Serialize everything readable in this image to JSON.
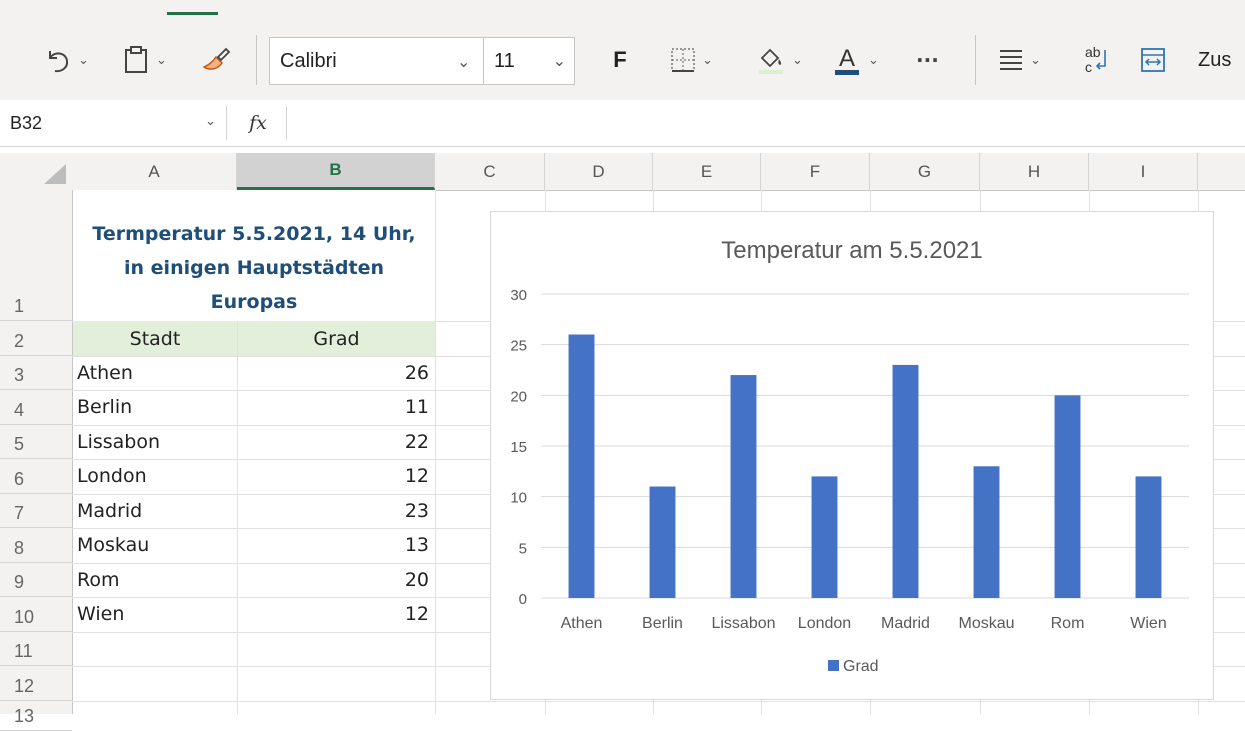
{
  "toolbar": {
    "font_name": "Calibri",
    "font_size": "11",
    "bold_label": "F",
    "more_label": "···",
    "truncated_label": "Zus",
    "icons": [
      "undo-icon",
      "clipboard-icon",
      "format-painter-icon",
      "borders-icon",
      "fill-color-icon",
      "font-color-icon",
      "align-icon",
      "wrap-text-icon",
      "merge-icon"
    ],
    "accent_color": "#217346",
    "font_color_bar": "#1f4e79"
  },
  "formula_bar": {
    "cell_ref": "B32",
    "fx_label": "fx",
    "value": ""
  },
  "grid": {
    "columns": [
      "A",
      "B",
      "C",
      "D",
      "E",
      "F",
      "G",
      "H",
      "I"
    ],
    "selected_column": "B",
    "rows": [
      "1",
      "2",
      "3",
      "4",
      "5",
      "6",
      "7",
      "8",
      "9",
      "10",
      "11",
      "12",
      "13"
    ]
  },
  "sheet": {
    "title_lines": [
      "Termperatur 5.5.2021, 14 Uhr,",
      "in einigen Hauptstädten",
      "Europas"
    ],
    "headers": [
      "Stadt",
      "Grad"
    ],
    "rows": [
      {
        "city": "Athen",
        "value": "26"
      },
      {
        "city": "Berlin",
        "value": "11"
      },
      {
        "city": "Lissabon",
        "value": "22"
      },
      {
        "city": "London",
        "value": "12"
      },
      {
        "city": "Madrid",
        "value": "23"
      },
      {
        "city": "Moskau",
        "value": "13"
      },
      {
        "city": "Rom",
        "value": "20"
      },
      {
        "city": "Wien",
        "value": "12"
      }
    ],
    "title_color": "#1f4e79",
    "header_fill": "#e2efda"
  },
  "chart_data": {
    "type": "bar",
    "title": "Temperatur am 5.5.2021",
    "categories": [
      "Athen",
      "Berlin",
      "Lissabon",
      "London",
      "Madrid",
      "Moskau",
      "Rom",
      "Wien"
    ],
    "series": [
      {
        "name": "Grad",
        "values": [
          26,
          11,
          22,
          12,
          23,
          13,
          20,
          12
        ],
        "color": "#4472c4"
      }
    ],
    "yticks": [
      0,
      5,
      10,
      15,
      20,
      25,
      30
    ],
    "ylim": [
      0,
      30
    ],
    "xlabel": "",
    "ylabel": "",
    "grid": true,
    "legend": "bottom"
  }
}
